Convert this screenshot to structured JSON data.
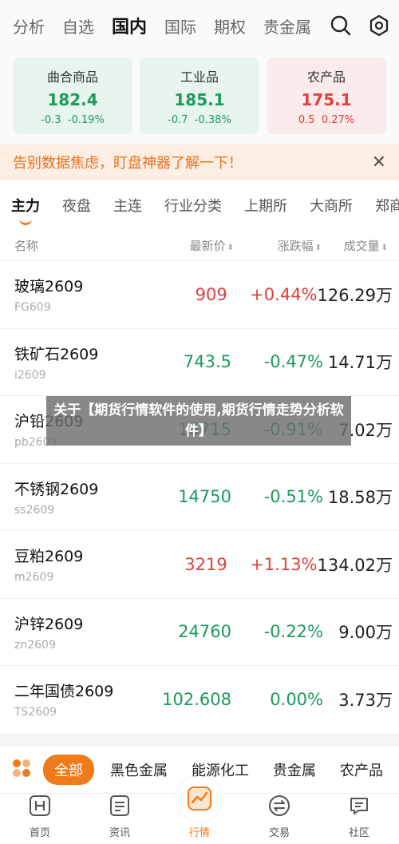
{
  "topnav": {
    "tabs": [
      "分析",
      "自选",
      "国内",
      "国际",
      "期权",
      "贵金属"
    ],
    "active_index": 2
  },
  "index_cards": [
    {
      "name": "曲合商品",
      "value": "182.4",
      "change": "-0.3",
      "pct": "-0.19%",
      "trend": "down"
    },
    {
      "name": "工业品",
      "value": "185.1",
      "change": "-0.7",
      "pct": "-0.38%",
      "trend": "down"
    },
    {
      "name": "农产品",
      "value": "175.1",
      "change": "0.5",
      "pct": "0.27%",
      "trend": "up"
    }
  ],
  "banner": {
    "text": "告别数据焦虑，盯盘神器了解一下！",
    "close": "✕"
  },
  "subtabs": [
    "主力",
    "夜盘",
    "主连",
    "行业分类",
    "上期所",
    "大商所",
    "郑商所"
  ],
  "table": {
    "headers": {
      "name": "名称",
      "price": "最新价",
      "change": "涨跌幅",
      "volume": "成交量"
    },
    "rows": [
      {
        "name": "玻璃2609",
        "code": "FG609",
        "price": "909",
        "change": "+0.44%",
        "volume": "126.29万",
        "trend": "up"
      },
      {
        "name": "铁矿石2609",
        "code": "i2609",
        "price": "743.5",
        "change": "-0.47%",
        "volume": "14.71万",
        "trend": "down"
      },
      {
        "name": "沪铅2609",
        "code": "pb2609",
        "price": "16715",
        "change": "-0.91%",
        "volume": "7.02万",
        "trend": "down"
      },
      {
        "name": "不锈钢2609",
        "code": "ss2609",
        "price": "14750",
        "change": "-0.51%",
        "volume": "18.58万",
        "trend": "down"
      },
      {
        "name": "豆粕2609",
        "code": "m2609",
        "price": "3219",
        "change": "+1.13%",
        "volume": "134.02万",
        "trend": "up"
      },
      {
        "name": "沪锌2609",
        "code": "zn2609",
        "price": "24760",
        "change": "-0.22%",
        "volume": "9.00万",
        "trend": "down"
      },
      {
        "name": "二年国债2609",
        "code": "TS2609",
        "price": "102.608",
        "change": "0.00%",
        "volume": "3.73万",
        "trend": "flat"
      }
    ]
  },
  "overlay": {
    "title": "关于【期货行情软件的使用,期货行情走势分析软件】"
  },
  "catbar": {
    "items": [
      "全部",
      "黑色金属",
      "能源化工",
      "贵金属",
      "农产品"
    ],
    "active_index": 0
  },
  "bottomnav": {
    "items": [
      {
        "label": "首页",
        "icon": "home-h-icon"
      },
      {
        "label": "资讯",
        "icon": "news-icon"
      },
      {
        "label": "行情",
        "icon": "chart-icon"
      },
      {
        "label": "交易",
        "icon": "trade-icon"
      },
      {
        "label": "社区",
        "icon": "community-icon"
      }
    ],
    "active_index": 2
  },
  "colors": {
    "accent": "#f07b1a",
    "up": "#e0413d",
    "down": "#1a9b5c",
    "banner_bg": "#fdeee3"
  }
}
